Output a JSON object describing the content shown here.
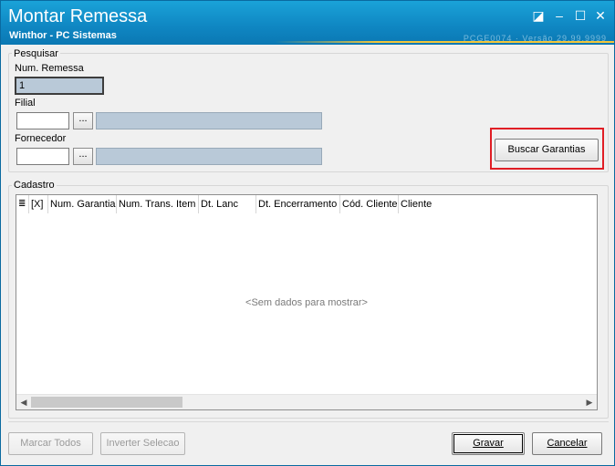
{
  "window": {
    "title": "Montar Remessa",
    "subtitle": "Winthor - PC Sistemas",
    "version_text": "PCGE0074 · Versão 29.99.9999",
    "controls": {
      "restore": "◪",
      "minimize": "–",
      "maximize": "☐",
      "close": "✕"
    }
  },
  "pesquisar": {
    "legend": "Pesquisar",
    "num_remessa_label": "Num. Remessa",
    "num_remessa_value": "1",
    "filial_label": "Filial",
    "filial_value": "",
    "fornecedor_label": "Fornecedor",
    "fornecedor_value": "",
    "ellipsis": "...",
    "buscar_label": "Buscar Garantias"
  },
  "cadastro": {
    "legend": "Cadastro",
    "columns": [
      "[X]",
      "Num. Garantia",
      "Num. Trans. Item",
      "Dt. Lanc",
      "Dt. Encerramento",
      "Cód. Cliente",
      "Cliente"
    ],
    "empty_text": "<Sem dados para mostrar>"
  },
  "footer": {
    "marcar_todos": "Marcar Todos",
    "inverter_selecao": "Inverter Selecao",
    "gravar": "Gravar",
    "cancelar": "Cancelar"
  },
  "colors": {
    "title_bar": "#0f86c2",
    "highlight": "#e01e25",
    "disabled_field": "#b9c9d8"
  }
}
